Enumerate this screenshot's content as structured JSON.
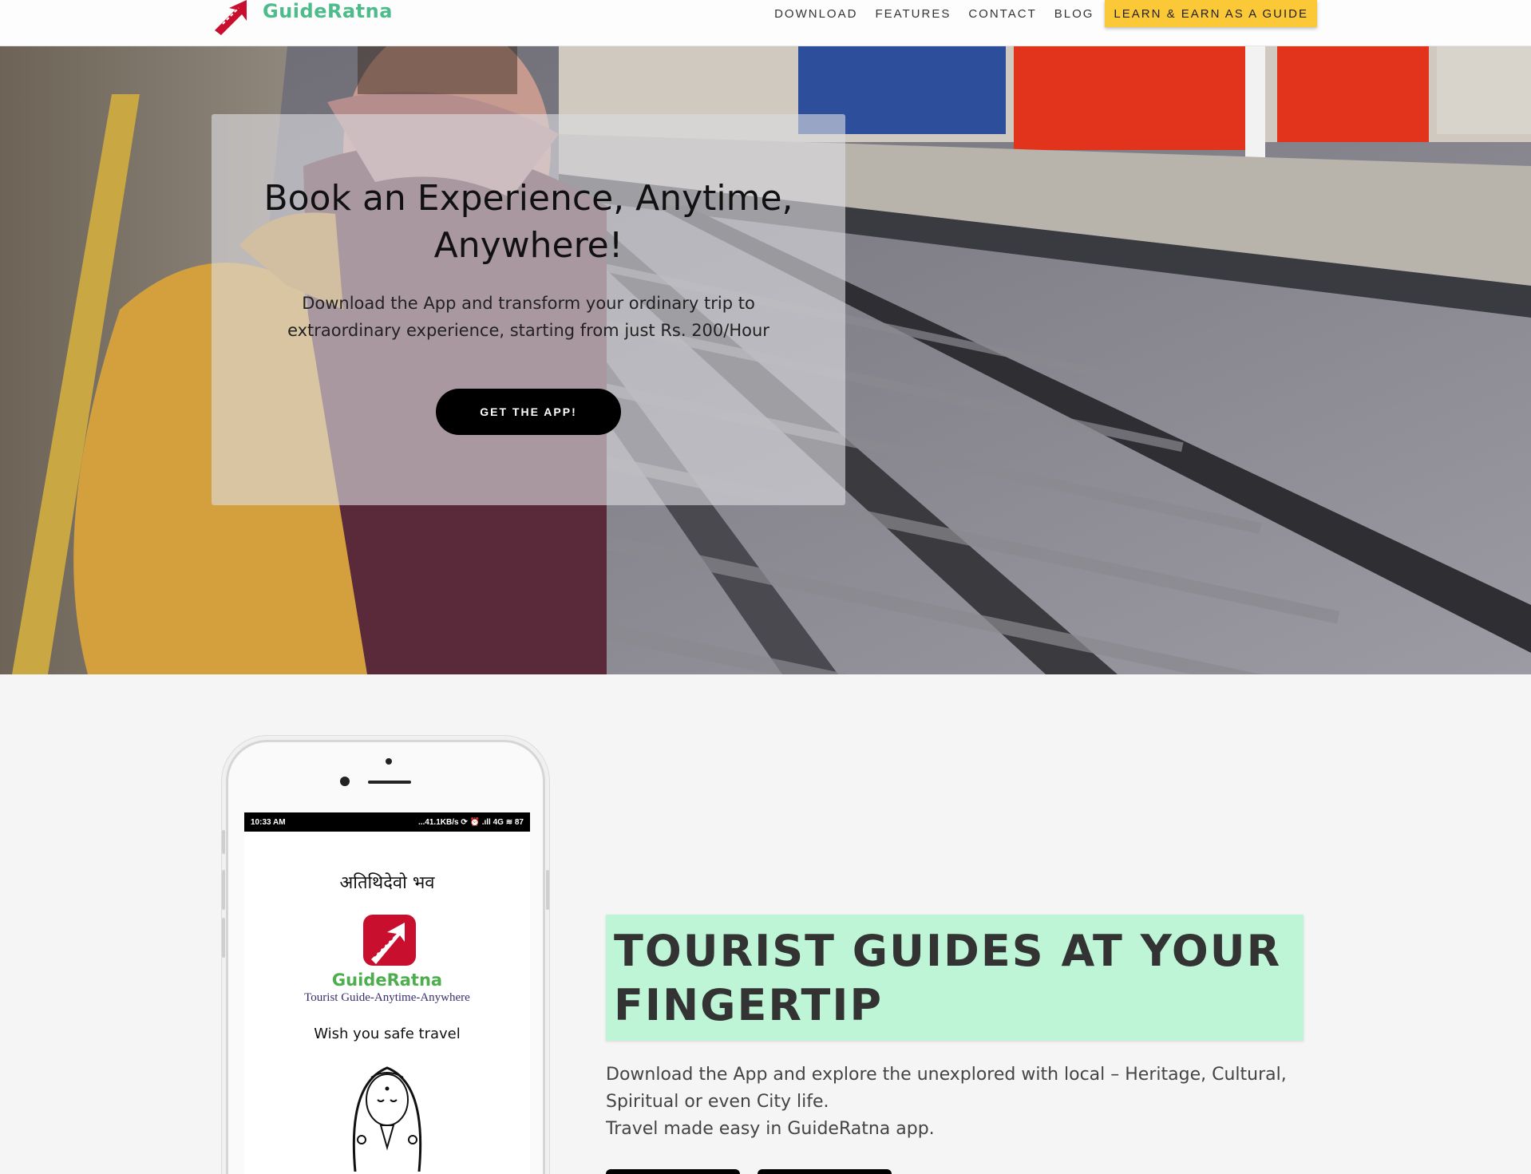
{
  "brand": {
    "name": "GuideRatna",
    "logo_color": "#c8102e",
    "name_color": "#4dbb8a"
  },
  "nav": {
    "links": [
      "DOWNLOAD",
      "FEATURES",
      "CONTACT",
      "BLOG"
    ],
    "cta": "LEARN & EARN AS A GUIDE",
    "cta_color": "#fbc837"
  },
  "hero": {
    "title": "Book an Experience, Anytime, Anywhere!",
    "subtitle": "Download the App and transform your ordinary trip to extraordinary experience, starting from just Rs. 200/Hour",
    "button": "GET THE APP!"
  },
  "phone": {
    "status_time": "10:33 AM",
    "status_right": "...41.1KB/s ⟳ ⏰ .ıll 4G ≋ 87",
    "hindi": "अतिथिदेवो भव",
    "brand": "GuideRatna",
    "tagline": "Tourist Guide-Anytime-Anywhere",
    "wish": "Wish you safe travel"
  },
  "feature": {
    "title": "TOURIST GUIDES AT YOUR FINGERTIP",
    "highlight_color": "#bdf5d6",
    "line1": "Download the App and explore the unexplored with local – Heritage, Cultural, Spiritual or even City life.",
    "line2": "Travel made easy in GuideRatna app."
  }
}
